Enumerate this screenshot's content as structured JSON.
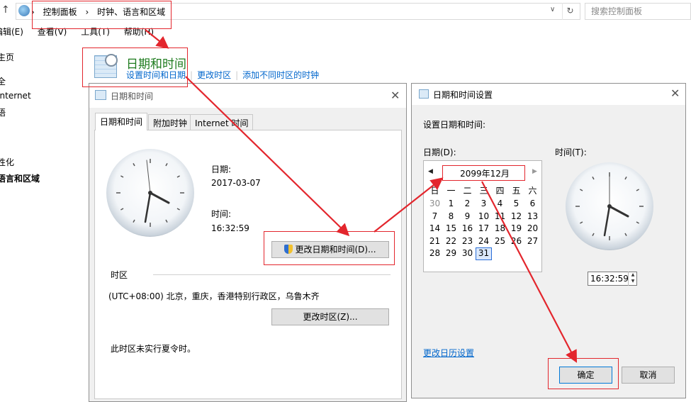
{
  "explorer": {
    "breadcrumb": [
      "控制面板",
      "时钟、语言和区域"
    ],
    "search_placeholder": "搜索控制面板",
    "menu": [
      "编辑(E)",
      "查看(V)",
      "工具(T)",
      "帮助(H)"
    ],
    "left_nav": [
      "主页",
      "全",
      "Internet",
      "语",
      "性化",
      "语言和区域"
    ]
  },
  "section": {
    "title": "日期和时间",
    "links": [
      "设置时间和日期",
      "更改时区",
      "添加不同时区的时钟"
    ]
  },
  "window1": {
    "title": "日期和时间",
    "tabs": [
      "日期和时间",
      "附加时钟",
      "Internet 时间"
    ],
    "date_label": "日期:",
    "date_value": "2017-03-07",
    "time_label": "时间:",
    "time_value": "16:32:59",
    "change_dt_button": "更改日期和时间(D)...",
    "timezone_label": "时区",
    "timezone_value": "(UTC+08:00) 北京，重庆，香港特别行政区，乌鲁木齐",
    "change_tz_button": "更改时区(Z)...",
    "dst_note": "此时区未实行夏令时。"
  },
  "window2": {
    "title": "日期和时间设置",
    "heading": "设置日期和时间:",
    "date_label": "日期(D):",
    "time_label": "时间(T):",
    "calendar": {
      "month": "2099年12月",
      "weekdays": [
        "日",
        "一",
        "二",
        "三",
        "四",
        "五",
        "六"
      ],
      "weeks": [
        [
          "30",
          "1",
          "2",
          "3",
          "4",
          "5",
          "6"
        ],
        [
          "7",
          "8",
          "9",
          "10",
          "11",
          "12",
          "13"
        ],
        [
          "14",
          "15",
          "16",
          "17",
          "18",
          "19",
          "20"
        ],
        [
          "21",
          "22",
          "23",
          "24",
          "25",
          "26",
          "27"
        ],
        [
          "28",
          "29",
          "30",
          "31",
          "",
          "",
          ""
        ]
      ],
      "selected": "31"
    },
    "time_value": "16:32:59",
    "calendar_settings_link": "更改日历设置",
    "ok_button": "确定",
    "cancel_button": "取消"
  },
  "colors": {
    "accent": "#0066cc",
    "annotation": "#e3262d",
    "title_green": "#1e7b1e"
  }
}
